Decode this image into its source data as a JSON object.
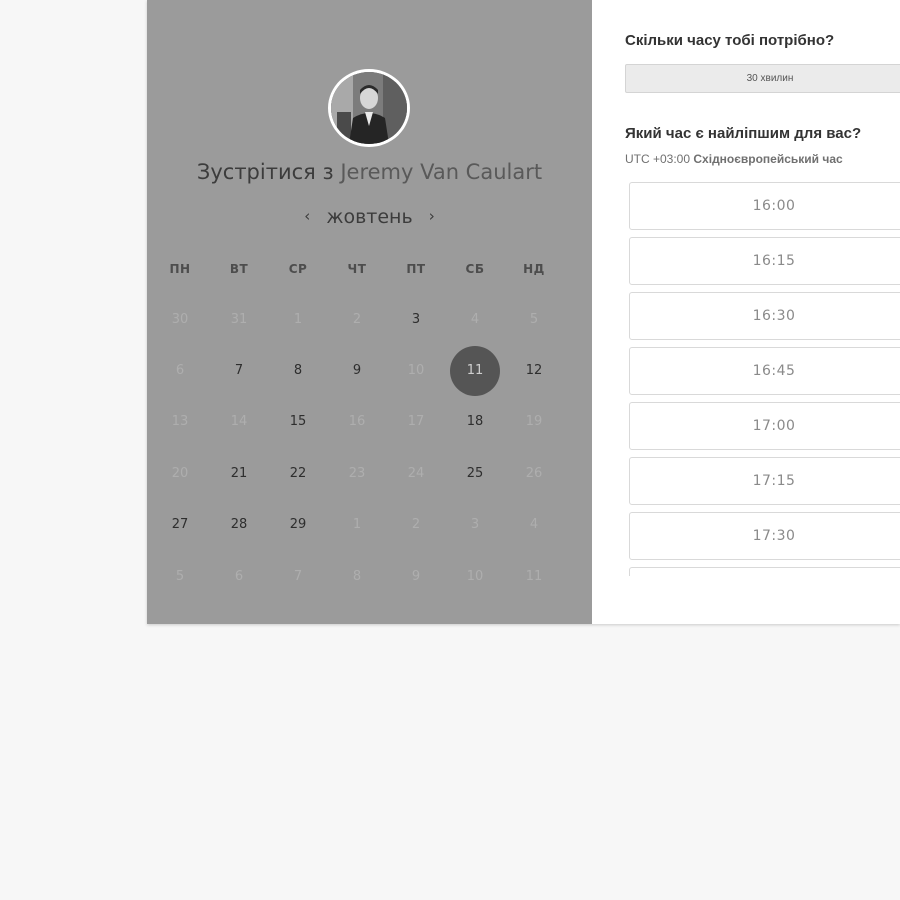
{
  "calendar_panel": {
    "avatar_alt": "Jeremy Van Caulart",
    "title_prefix": "Зустрітися з",
    "host_name": "Jeremy Van Caulart",
    "month_label": "жовтень",
    "prev_month_glyph": "‹",
    "next_month_glyph": "›",
    "weekdays": [
      "ПН",
      "ВТ",
      "СР",
      "ЧТ",
      "ПТ",
      "СБ",
      "НД"
    ],
    "weeks": [
      [
        {
          "day": "30",
          "state": "muted"
        },
        {
          "day": "31",
          "state": "muted"
        },
        {
          "day": "1",
          "state": "muted"
        },
        {
          "day": "2",
          "state": "muted"
        },
        {
          "day": "3",
          "state": "avail"
        },
        {
          "day": "4",
          "state": "muted"
        },
        {
          "day": "5",
          "state": "muted"
        }
      ],
      [
        {
          "day": "6",
          "state": "muted"
        },
        {
          "day": "7",
          "state": "avail"
        },
        {
          "day": "8",
          "state": "avail"
        },
        {
          "day": "9",
          "state": "avail"
        },
        {
          "day": "10",
          "state": "muted"
        },
        {
          "day": "11",
          "state": "selected"
        },
        {
          "day": "12",
          "state": "avail"
        }
      ],
      [
        {
          "day": "13",
          "state": "muted"
        },
        {
          "day": "14",
          "state": "muted"
        },
        {
          "day": "15",
          "state": "avail"
        },
        {
          "day": "16",
          "state": "muted"
        },
        {
          "day": "17",
          "state": "muted"
        },
        {
          "day": "18",
          "state": "avail"
        },
        {
          "day": "19",
          "state": "muted"
        }
      ],
      [
        {
          "day": "20",
          "state": "muted"
        },
        {
          "day": "21",
          "state": "avail"
        },
        {
          "day": "22",
          "state": "avail"
        },
        {
          "day": "23",
          "state": "muted"
        },
        {
          "day": "24",
          "state": "muted"
        },
        {
          "day": "25",
          "state": "avail"
        },
        {
          "day": "26",
          "state": "muted"
        }
      ],
      [
        {
          "day": "27",
          "state": "avail"
        },
        {
          "day": "28",
          "state": "avail"
        },
        {
          "day": "29",
          "state": "avail"
        },
        {
          "day": "1",
          "state": "muted"
        },
        {
          "day": "2",
          "state": "muted"
        },
        {
          "day": "3",
          "state": "muted"
        },
        {
          "day": "4",
          "state": "muted"
        }
      ],
      [
        {
          "day": "5",
          "state": "muted"
        },
        {
          "day": "6",
          "state": "muted"
        },
        {
          "day": "7",
          "state": "muted"
        },
        {
          "day": "8",
          "state": "muted"
        },
        {
          "day": "9",
          "state": "muted"
        },
        {
          "day": "10",
          "state": "muted"
        },
        {
          "day": "11",
          "state": "muted"
        }
      ]
    ]
  },
  "booking_panel": {
    "duration_question": "Скільки часу тобі потрібно?",
    "duration_value": "30 хвилин",
    "time_question": "Який час є найліпшим для вас?",
    "timezone_offset": "UTC +03:00",
    "timezone_name": "Східноєвропейський час",
    "time_slots": [
      "16:00",
      "16:15",
      "16:30",
      "16:45",
      "17:00",
      "17:15",
      "17:30",
      ""
    ]
  },
  "colors": {
    "page_background": "#f7f7f7",
    "calendar_panel_background": "#9b9b9b",
    "selected_day": "#555555",
    "slot_border": "#d9d9d9"
  },
  "icons": [
    "avatar-photo",
    "chevron-left-icon",
    "chevron-right-icon"
  ]
}
